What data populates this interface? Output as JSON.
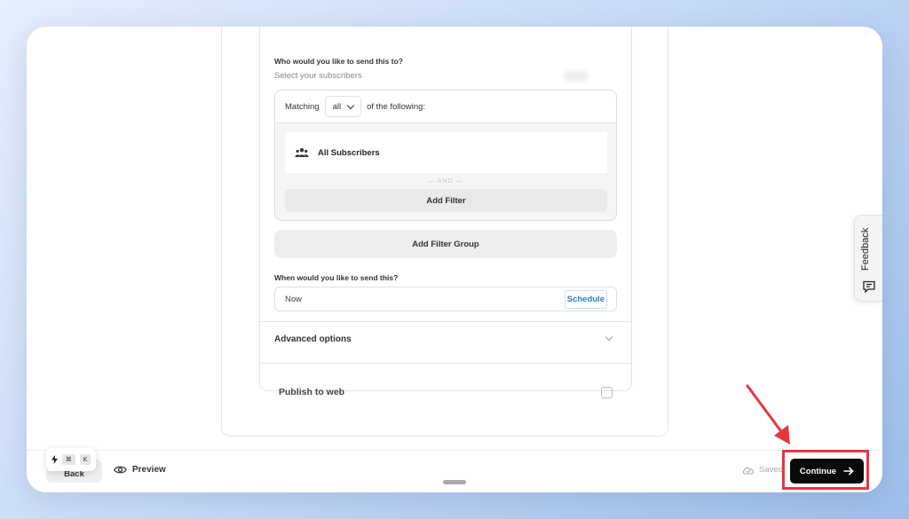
{
  "form": {
    "recipients_question": "Who would you like to send this to?",
    "recipients_subtitle": "Select your subscribers",
    "matching_prefix": "Matching",
    "matching_value": "all",
    "matching_suffix": "of the following:",
    "segment_label": "All Subscribers",
    "and_separator": "AND",
    "add_filter_label": "Add Filter",
    "add_filter_group_label": "Add Filter Group",
    "when_question": "When would you like to send this?",
    "when_value": "Now",
    "schedule_label": "Schedule",
    "advanced_label": "Advanced options",
    "publish_label": "Publish to web"
  },
  "footer": {
    "back_label": "Back",
    "shortcut_keys": [
      "⌘",
      "K"
    ],
    "preview_label": "Preview",
    "saved_label": "Saved",
    "continue_label": "Continue"
  },
  "sidebar": {
    "feedback_label": "Feedback"
  },
  "icons": {
    "users": "users-icon",
    "chevron": "chevron-down-icon",
    "eye": "eye-icon",
    "cloud": "cloud-check-icon",
    "arrow": "arrow-right-icon",
    "bolt": "lightning-icon",
    "feedback": "chat-bubble-icon"
  },
  "colors": {
    "accent_link": "#2f7fb9",
    "continue_bg": "#0a0a0a",
    "annotation_red": "#e8363f"
  }
}
